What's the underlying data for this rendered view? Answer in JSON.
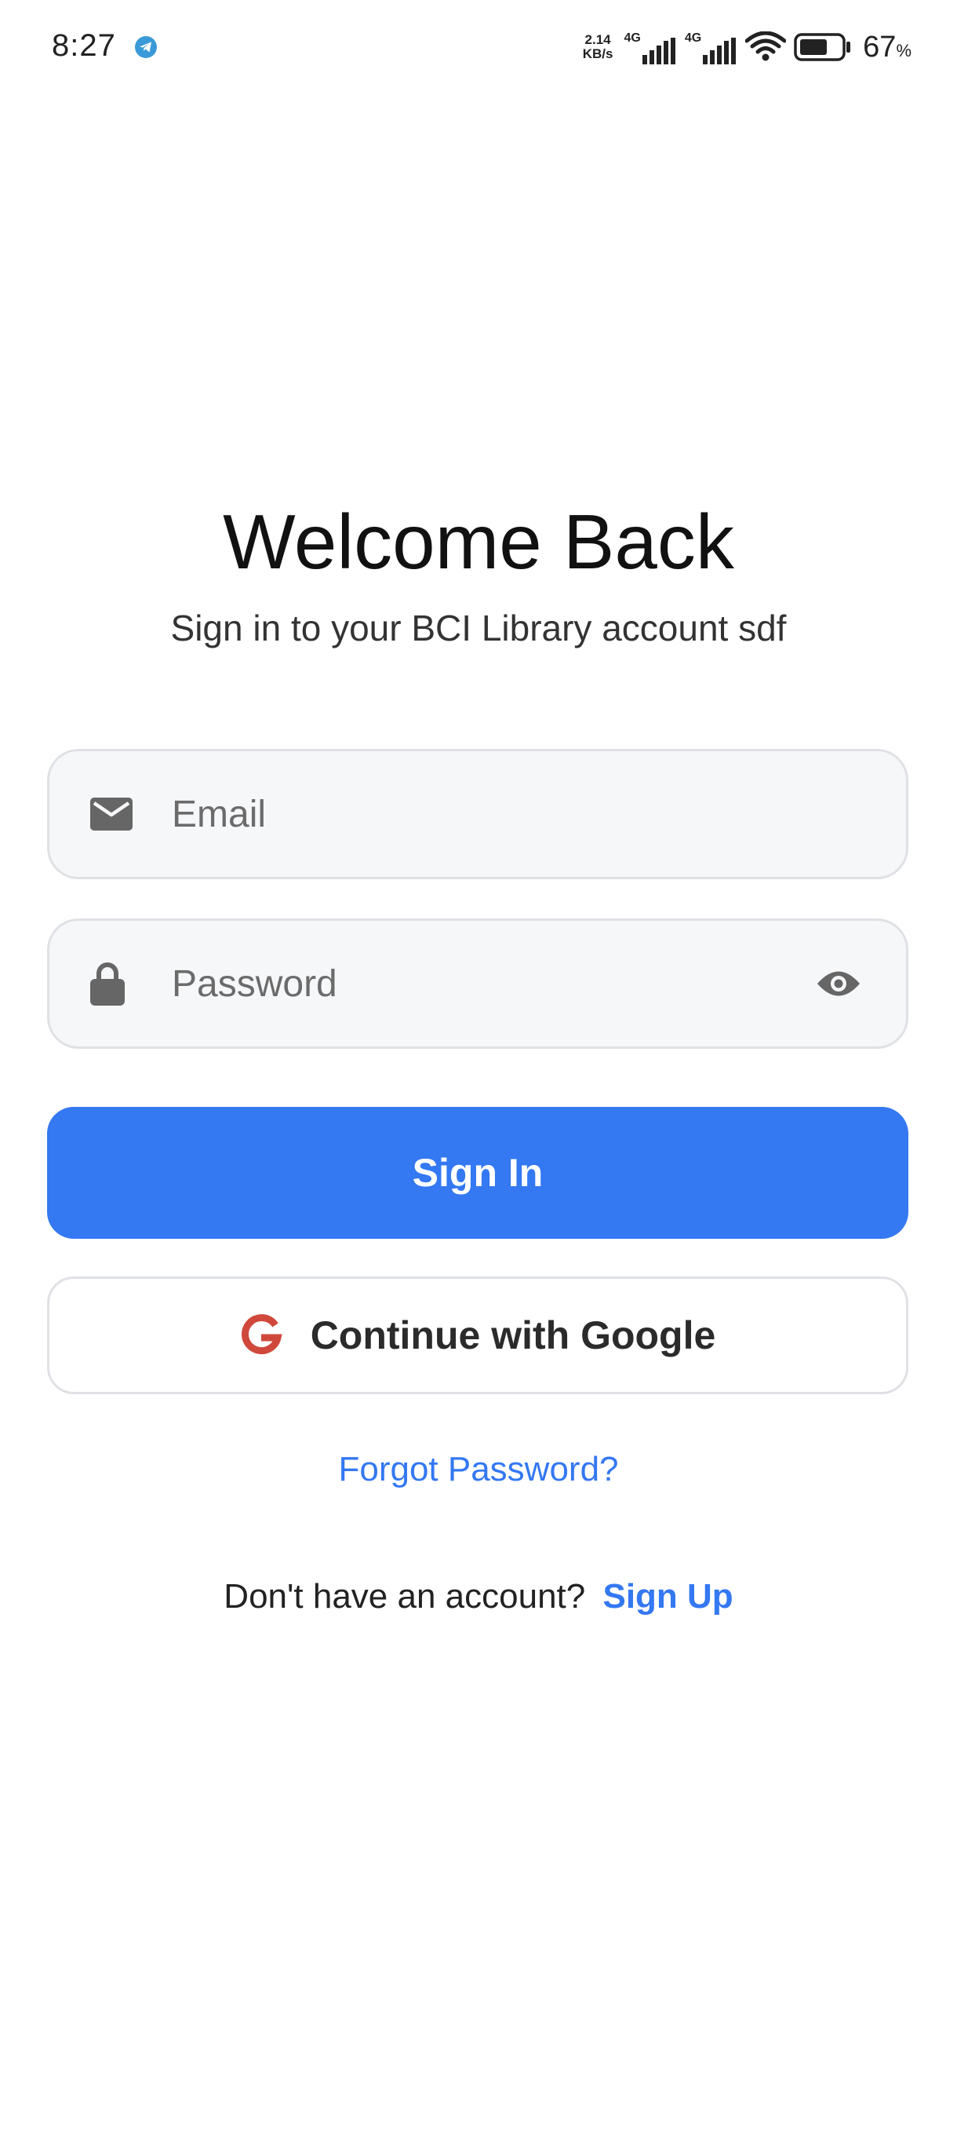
{
  "status_bar": {
    "time": "8:27",
    "net_speed_value": "2.14",
    "net_speed_unit": "KB/s",
    "sim1_type": "4G",
    "sim2_type": "4G",
    "battery_percent": "67",
    "battery_suffix": "%",
    "battery_level": 0.67
  },
  "login": {
    "title": "Welcome Back",
    "subtitle": "Sign in to your BCI Library account sdf",
    "email": {
      "placeholder": "Email",
      "value": "",
      "icon": "mail-icon"
    },
    "password": {
      "placeholder": "Password",
      "value": "",
      "icon": "lock-icon",
      "toggle_icon": "eye-icon"
    },
    "sign_in_label": "Sign In",
    "google_label": "Continue with Google",
    "forgot_label": "Forgot Password?",
    "signup_prompt": "Don't have an account?",
    "signup_label": "Sign Up"
  },
  "colors": {
    "primary": "#3478f2",
    "google_red": "#d0483c",
    "field_bg": "#f6f7f9",
    "field_border": "#dfe1e5",
    "icon_gray": "#666666"
  }
}
